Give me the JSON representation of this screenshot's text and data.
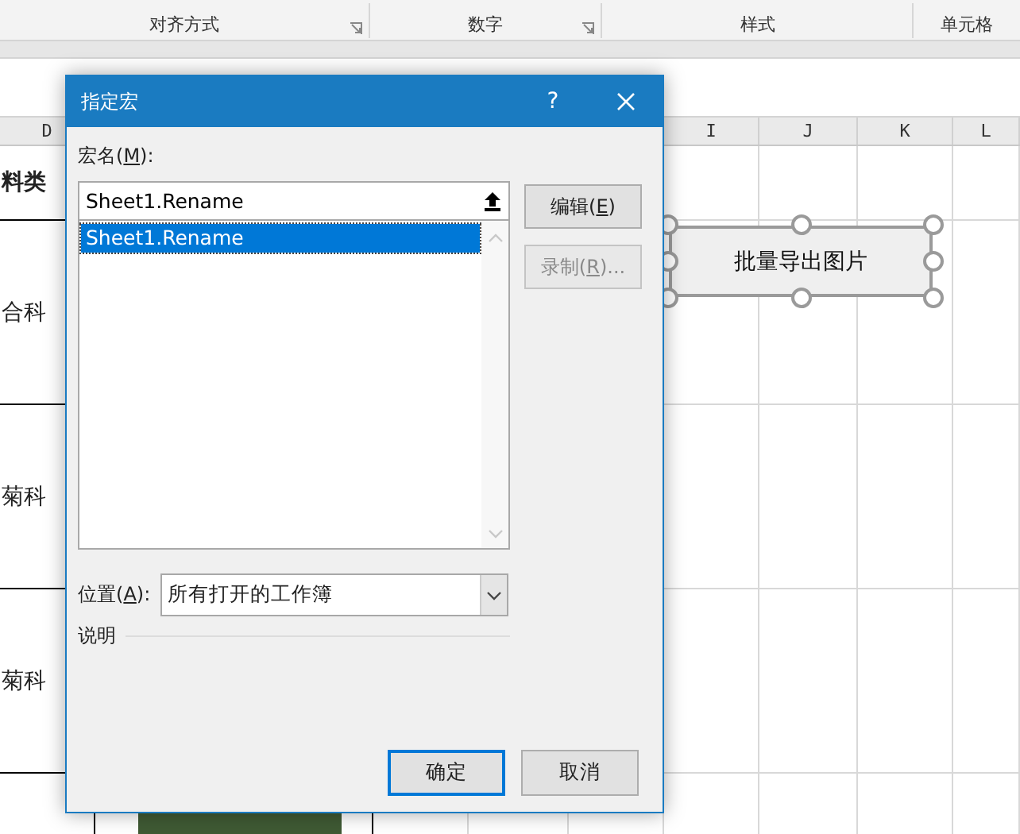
{
  "ribbon": {
    "groups": [
      {
        "label": "对齐方式",
        "launcher": true
      },
      {
        "label": "数字",
        "launcher": true
      },
      {
        "label": "样式",
        "launcher": false
      },
      {
        "label": "单元格",
        "launcher": false
      }
    ]
  },
  "sheet": {
    "column_headers": [
      "D",
      "I",
      "J",
      "K",
      "L"
    ],
    "rows": [
      {
        "cell": "料类",
        "bold": true
      },
      {
        "cell": "合科",
        "bold": false
      },
      {
        "cell": "菊科",
        "bold": false
      },
      {
        "cell": "菊科",
        "bold": false
      }
    ],
    "shape_button": {
      "label": "批量导出图片",
      "selected": true
    }
  },
  "dialog": {
    "title": "指定宏",
    "help": "?",
    "macro_name": {
      "before": "宏名(",
      "key": "M",
      "after": "):",
      "value": "Sheet1.Rename"
    },
    "macros": [
      {
        "label": "Sheet1.Rename",
        "selected": true
      }
    ],
    "side_buttons": [
      {
        "before": "编辑(",
        "key": "E",
        "after": ")",
        "disabled": false
      },
      {
        "before": "录制(",
        "key": "R",
        "after": ")...",
        "disabled": true
      }
    ],
    "location": {
      "before": "位置(",
      "key": "A",
      "after": "):",
      "value": "所有打开的工作簿"
    },
    "description_label": "说明",
    "buttons": [
      {
        "label": "确定",
        "default": true
      },
      {
        "label": "取消",
        "default": false
      }
    ]
  }
}
